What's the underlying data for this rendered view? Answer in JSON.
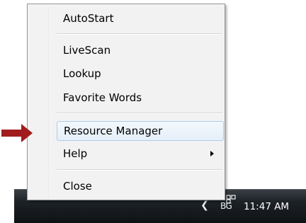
{
  "menu": {
    "items": [
      {
        "label": "AutoStart"
      },
      {
        "label": "LiveScan"
      },
      {
        "label": "Lookup"
      },
      {
        "label": "Favorite Words"
      },
      {
        "label": "Resource Manager"
      },
      {
        "label": "Help"
      },
      {
        "label": "Close"
      }
    ],
    "highlight_color": "#e4eff9",
    "highlight_border": "#aecbe6"
  },
  "taskbar": {
    "language": "BG",
    "clock": "11:47 AM",
    "chevron_icon": "chevron-left-icon"
  },
  "pointer": {
    "color": "#a11d1d",
    "icon": "right-arrow-icon"
  }
}
